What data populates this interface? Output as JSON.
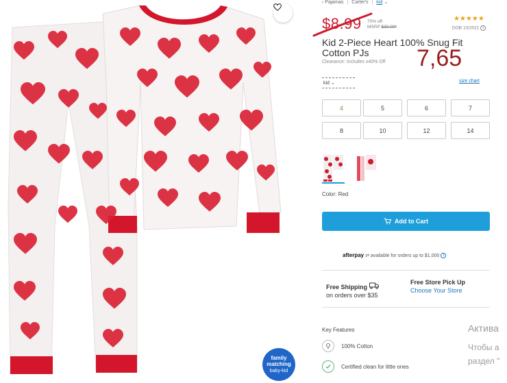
{
  "breadcrumb": {
    "items": [
      "Pajamas",
      "Carter's",
      "kid"
    ]
  },
  "price": {
    "original": "$8.99",
    "off": "70% off",
    "msrp_label": "MSRP",
    "msrp_value": "$30.00*",
    "sale_handwritten": "7,65"
  },
  "rating": {
    "stars": "★★★★★",
    "dob": "DOB 10/2021",
    "info_icon": "info-icon"
  },
  "product": {
    "title": "Kid 2-Piece Heart 100% Snug Fit Cotton PJs",
    "clearance": "Clearance: Includes x40% Off"
  },
  "sizes": {
    "selector_value": "kid",
    "size_chart": "size chart",
    "options": [
      "4",
      "5",
      "6",
      "7",
      "8",
      "10",
      "12",
      "14"
    ]
  },
  "color": {
    "label": "Color: Red",
    "selected_accent": "#1a9fd8"
  },
  "cart": {
    "button": "Add to Cart",
    "icon": "cart-icon",
    "color": "#1e9fdc"
  },
  "afterpay": {
    "logo": "afterpay",
    "text": "available for orders up to $1,000"
  },
  "shipping": {
    "free_title": "Free Shipping",
    "free_sub": "on orders over $35",
    "pickup_title": "Free Store Pick Up",
    "pickup_link": "Choose Your Store"
  },
  "features": {
    "title": "Key Features",
    "items": [
      {
        "label": "100% Cotton",
        "icon": "cotton-icon"
      },
      {
        "label": "Certified clean for little ones",
        "icon": "leaf-check-icon"
      }
    ]
  },
  "badge": {
    "line1": "family",
    "line2": "matching",
    "line3": "baby-kid"
  },
  "watermark": {
    "title": "Актива",
    "line1": "Чтобы а",
    "line2": "раздел \""
  },
  "colors": {
    "heart_red": "#cc1b2f",
    "brand_blue": "#1a75bb"
  }
}
